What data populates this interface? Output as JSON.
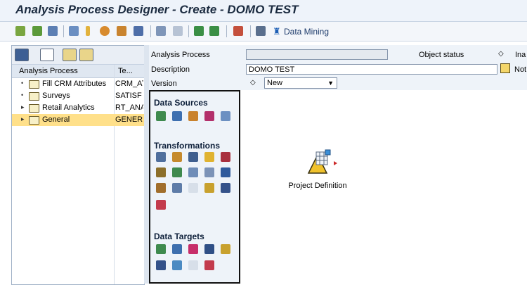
{
  "window": {
    "title": "Analysis Process Designer - Create - DOMO TEST"
  },
  "toolbar": {
    "data_mining_label": "Data Mining"
  },
  "tree": {
    "columns": [
      "Analysis Process",
      "Te..."
    ],
    "items": [
      {
        "name": "Fill CRM Attributes",
        "tech": "CRM_AT",
        "selected": false
      },
      {
        "name": "Surveys",
        "tech": "SATISF",
        "selected": false
      },
      {
        "name": "Retail Analytics",
        "tech": "RT_ANA",
        "selected": false
      },
      {
        "name": "General",
        "tech": "GENERI",
        "selected": true
      }
    ]
  },
  "form": {
    "analysis_process_label": "Analysis Process",
    "analysis_process_value": "",
    "object_status_label": "Object status",
    "object_status_value": "Ina",
    "description_label": "Description",
    "description_value": "DOMO TEST",
    "description_suffix": "Not",
    "version_label": "Version",
    "version_value": "New",
    "diamond": "◇"
  },
  "palette": {
    "data_sources": "Data Sources",
    "transformations": "Transformations",
    "data_targets": "Data Targets"
  },
  "canvas": {
    "node_label": "Project Definition"
  }
}
